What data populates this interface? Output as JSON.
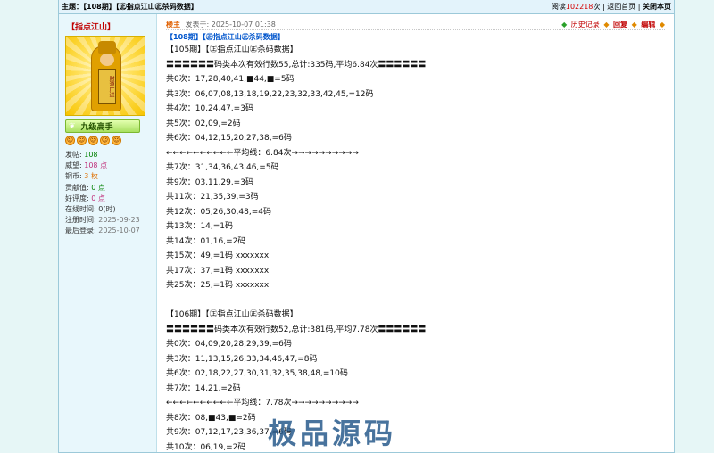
{
  "topbar": {
    "subject_label": "主题：",
    "subject": "【108期】【㊣指点江山㊣杀码数据】",
    "read_prefix": "阅读",
    "read_count": "102218",
    "read_suffix": "次",
    "sep1": "|",
    "back_home": "返回首页",
    "sep2": "|",
    "close_page": "关闭本页"
  },
  "user": {
    "name": "【指点江山】",
    "avatar_scroll": "财源广进",
    "rank": "九级高手",
    "rank_wing": "❦",
    "smile_glyph": "☺",
    "stats": [
      {
        "label": "发帖:",
        "value": "108"
      },
      {
        "label": "威望:",
        "value": "108 点"
      },
      {
        "label": "铜币:",
        "value": "3 枚"
      },
      {
        "label": "贡献值:",
        "value": "0 点"
      },
      {
        "label": "好评度:",
        "value": "0 点"
      },
      {
        "label": "在线时间:",
        "value": "0(时)"
      },
      {
        "label": "注册时间:",
        "value": "2025-09-23"
      },
      {
        "label": "最后登录:",
        "value": "2025-10-07"
      }
    ]
  },
  "post": {
    "author": "楼主",
    "date": "发表于: 2025-10-07 01:38",
    "actions": {
      "history": "历史记录",
      "reply": "回复",
      "edit": "编辑",
      "diamond": "◆"
    },
    "subject": "【108期】【㊣指点江山㊣杀码数据】",
    "lines": [
      "【105期】【㊣指点江山㊣杀码数据】",
      "〓〓〓〓〓〓码类本次有效行数55,总计:335码,平均6.84次〓〓〓〓〓〓",
      "共0次：17,28,40,41,■44,■=5码",
      "共3次：06,07,08,13,18,19,22,23,32,33,42,45,=12码",
      "共4次：10,24,47,=3码",
      "共5次：02,09,=2码",
      "共6次：04,12,15,20,27,38,=6码",
      "←←←←←←←←←←平均线：6.84次→→→→→→→→→→",
      "共7次：31,34,36,43,46,=5码",
      "共9次：03,11,29,=3码",
      "共11次：21,35,39,=3码",
      "共12次：05,26,30,48,=4码",
      "共13次：14,=1码",
      "共14次：01,16,=2码",
      "共15次：49,=1码 xxxxxxx",
      "共17次：37,=1码 xxxxxxx",
      "共25次：25,=1码 xxxxxxx",
      "",
      "【106期】【㊣指点江山㊣杀码数据】",
      "〓〓〓〓〓〓码类本次有效行数52,总计:381码,平均7.78次〓〓〓〓〓〓",
      "共0次：04,09,20,28,29,39,=6码",
      "共3次：11,13,15,26,33,34,46,47,=8码",
      "共6次：02,18,22,27,30,31,32,35,38,48,=10码",
      "共7次：14,21,=2码",
      "←←←←←←←←←←平均线：7.78次→→→→→→→→→→",
      "共8次：08,■43,■=2码",
      "共9次：07,12,17,23,36,37,=6码",
      "共10次：06,19,=2码"
    ]
  },
  "watermark": "极品源码"
}
